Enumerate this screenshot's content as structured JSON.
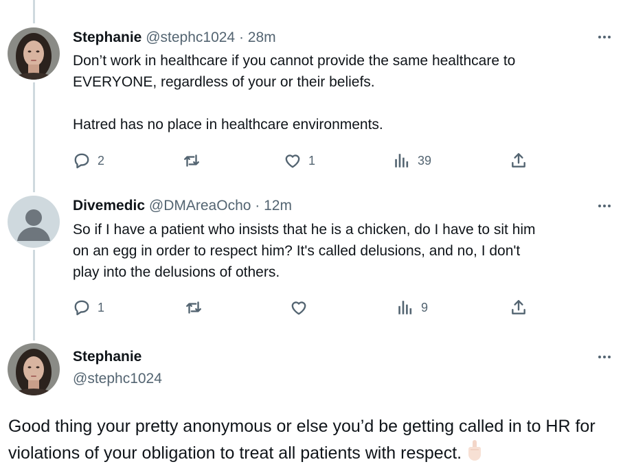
{
  "tweets": [
    {
      "name": "Stephanie",
      "handle": "@stephc1024",
      "time": "· 28m",
      "text": "Don’t work in healthcare if you cannot provide the same healthcare to\nEVERYONE, regardless of your or their beliefs.\n\nHatred has no place in healthcare environments.",
      "replies": "2",
      "likes": "1",
      "views": "39"
    },
    {
      "name": "Divemedic",
      "handle": "@DMAreaOcho",
      "time": "· 12m",
      "text": "So if I have a patient who insists that he is a chicken, do I have to sit him\non an egg in order to respect him? It's called delusions, and no, I don't\nplay into the delusions of others.",
      "replies": "1",
      "likes": "",
      "views": "9"
    }
  ],
  "focused": {
    "name": "Stephanie",
    "handle": "@stephc1024",
    "text": "Good thing your pretty anonymous or else you’d be getting called in to HR for violations of your obligation to treat all patients with respect."
  },
  "icons": {
    "reply": "reply-icon",
    "retweet": "retweet-icon",
    "like": "like-icon",
    "views": "views-icon",
    "share": "share-icon",
    "more": "more-icon",
    "emoji": "middle-finger-emoji"
  },
  "colors": {
    "text": "#0f1419",
    "muted": "#536471",
    "thread_line": "#cfd9de"
  }
}
